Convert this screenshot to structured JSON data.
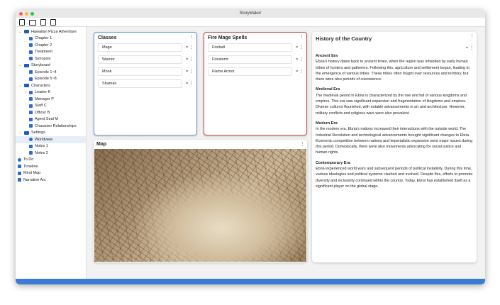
{
  "app": {
    "title": "StoryMaker"
  },
  "colors": {
    "accent": "#2f6fd6",
    "classes_border": "#6e9bd6",
    "spells_border": "#c94b4b"
  },
  "sidebar": {
    "items": [
      {
        "label": "Hawaiian Pizza Adventure",
        "icon": "folder-icon",
        "level": 0,
        "chevron": "v"
      },
      {
        "label": "Chapter 1",
        "icon": "document-icon",
        "level": 1
      },
      {
        "label": "Chapter 2",
        "icon": "document-icon",
        "level": 1
      },
      {
        "label": "Treatment",
        "icon": "document-icon",
        "level": 1
      },
      {
        "label": "Synopsis",
        "icon": "document-icon",
        "level": 1
      },
      {
        "label": "Storyboard",
        "icon": "folder-icon",
        "level": 0,
        "chevron": "v"
      },
      {
        "label": "Episode 1~4",
        "icon": "image-icon",
        "level": 1
      },
      {
        "label": "Episode 5~8",
        "icon": "image-icon",
        "level": 1
      },
      {
        "label": "Characters",
        "icon": "folder-icon",
        "level": 0,
        "chevron": "v"
      },
      {
        "label": "Leader K",
        "icon": "person-icon",
        "level": 1,
        "chevron": ">"
      },
      {
        "label": "Manager P",
        "icon": "person-icon",
        "level": 1
      },
      {
        "label": "Staff C",
        "icon": "person-icon",
        "level": 1
      },
      {
        "label": "Officer B",
        "icon": "person-icon",
        "level": 1
      },
      {
        "label": "Agent Seal M",
        "icon": "person-icon",
        "level": 1
      },
      {
        "label": "Character Relationships",
        "icon": "graph-icon",
        "level": 1
      },
      {
        "label": "Settings",
        "icon": "folder-icon",
        "level": 0,
        "chevron": "v"
      },
      {
        "label": "Worldview",
        "icon": "globe-icon",
        "level": 1,
        "selected": true
      },
      {
        "label": "Notes 1",
        "icon": "document-icon",
        "level": 1
      },
      {
        "label": "Notes 2",
        "icon": "document-icon",
        "level": 1
      },
      {
        "label": "To Do",
        "icon": "check-circle-icon",
        "level": -1
      },
      {
        "label": "Timeline",
        "icon": "timeline-icon",
        "level": -1
      },
      {
        "label": "Mind Map",
        "icon": "mindmap-icon",
        "level": -1
      },
      {
        "label": "Narrative Arc",
        "icon": "graph-icon",
        "level": -1
      }
    ]
  },
  "cards": {
    "classes": {
      "title": "Classes",
      "items": [
        "Mage",
        "Warrior",
        "Monk",
        "Shaman"
      ]
    },
    "spells": {
      "title": "Fire Mage Spells",
      "items": [
        "Fireball",
        "Firestorm",
        "Flame Armor"
      ]
    },
    "map": {
      "title": "Map"
    },
    "history": {
      "title": "History of the Country",
      "sections": [
        {
          "heading": "Ancient Era",
          "text": "Ebria's history dates back to ancient times, when the region was inhabited by early human tribes of hunters and gatherers. Following this, agriculture and settlement began, leading to the emergence of various tribes. These tribes often fought over resources and territory, but there were also periods of coexistence."
        },
        {
          "heading": "Medieval Era",
          "text": "The medieval period in Ebria is characterized by the rise and fall of various kingdoms and empires. This era saw significant expansion and fragmentation of kingdoms and empires. Diverse cultures flourished, with notable advancements in art and architecture. However, military conflicts and religious wars were also prevalent."
        },
        {
          "heading": "Modern Era",
          "text": "In the modern era, Ebria's nations increased their interactions with the outside world. The Industrial Revolution and technological advancements brought significant changes to Ebria. Economic competition between nations and imperialistic expansion were major issues during this period. Domestically, there were also movements advocating for social justice and human rights."
        },
        {
          "heading": "Contemporary Era",
          "text": "Ebria experienced world wars and subsequent periods of political instability. During this time, various ideologies and political systems clashed and evolved. Despite this, efforts to promote diversity and inclusivity continued within the country. Today, Ebria has established itself as a significant player on the global stage."
        }
      ]
    }
  },
  "fab": {
    "label": "+"
  }
}
